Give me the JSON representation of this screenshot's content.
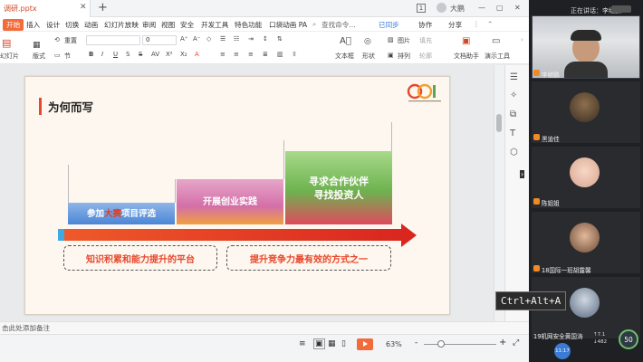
{
  "window": {
    "doc_tab_title": "调研.pptx",
    "new_tab_symbol": "+",
    "page_badge": "1",
    "user_name": "大鹏"
  },
  "menu": {
    "items": [
      "开始",
      "插入",
      "设计",
      "切换",
      "动画",
      "幻灯片放映",
      "审阅",
      "视图",
      "安全",
      "开发工具",
      "特色功能",
      "口袋动画 PA",
      "查找命令..."
    ],
    "right_items": [
      "已同步",
      "协作",
      "分享"
    ]
  },
  "ribbon": {
    "reset_label": "重置",
    "slide_label": "幻灯片",
    "layout_label": "版式",
    "section_label": "节",
    "font_size_value": "0",
    "textbox_label": "文本框",
    "shape_label": "形状",
    "arrange_label": "排列",
    "picture_label": "图片",
    "fill_label": "填充",
    "outline_label": "轮廓",
    "doc_helper_label": "文档助手",
    "present_tool_label": "演示工具"
  },
  "slide": {
    "title": "为何而写",
    "step1_pre": "参加",
    "step1_highlight": "大赛",
    "step1_post": "项目评选",
    "step2": "开展创业实践",
    "step3_line1": "寻求合作伙伴",
    "step3_line2": "寻找投资人",
    "box_left": "知识积累和能力提升的平台",
    "box_right": "提升竞争力最有效的方式之一"
  },
  "status": {
    "notes_placeholder": "击此处添加备注",
    "zoom": "63%",
    "zoom_minus": "-",
    "zoom_plus": "+"
  },
  "meeting": {
    "title": "正在讲话：李继鹏",
    "participants": [
      {
        "name": "李继鹏"
      },
      {
        "name": "黑迪佳"
      },
      {
        "name": "陈姐姐"
      },
      {
        "name": "18国际一班胡露馨"
      },
      {
        "name": "19机网安全黄国涛"
      }
    ],
    "timer": "11:17",
    "net_up": "7.1",
    "net_down": "482",
    "cpu": "50"
  },
  "overlay": {
    "shortcut": "Ctrl+Alt+A"
  },
  "colors": {
    "accent_orange": "#f26b3a",
    "slide_red": "#e8472b",
    "meeting_bg": "#1f2023"
  }
}
